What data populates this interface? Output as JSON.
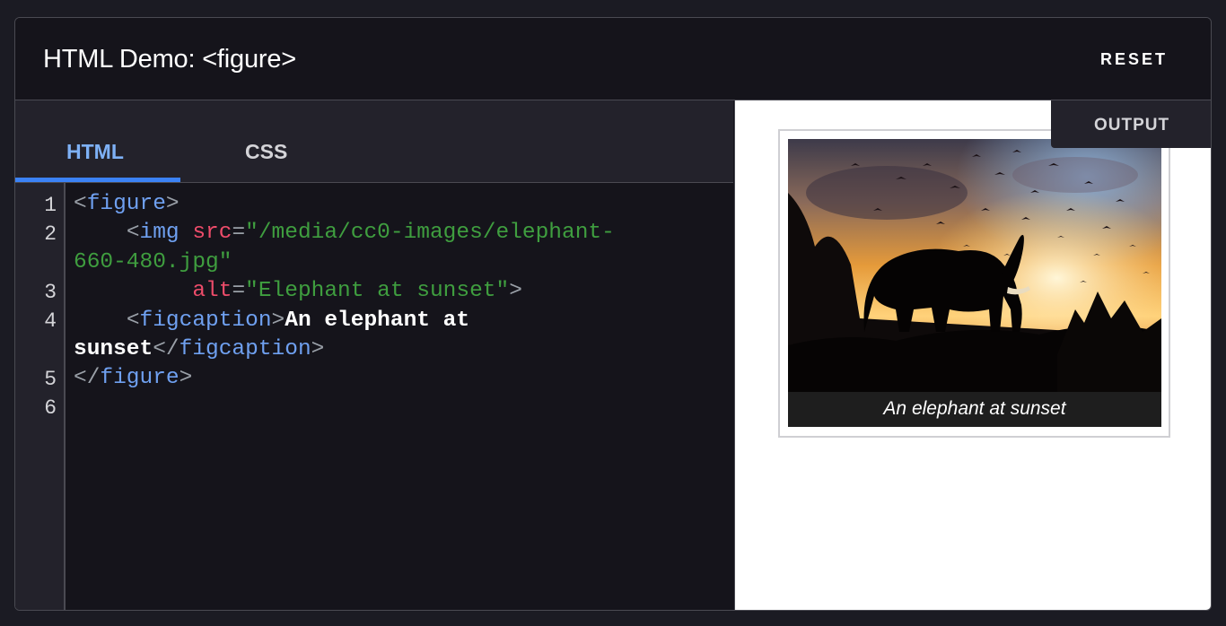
{
  "header": {
    "title": "HTML Demo: <figure>",
    "reset_label": "RESET"
  },
  "editor": {
    "tabs": [
      {
        "label": "HTML",
        "active": true
      },
      {
        "label": "CSS",
        "active": false
      }
    ],
    "line_numbers": [
      "1",
      "2",
      "3",
      "4",
      "5",
      "6"
    ],
    "code": {
      "l1_open": "<",
      "l1_tag": "figure",
      "l1_close": ">",
      "l2_indent": "    ",
      "l2_open": "<",
      "l2_tag": "img",
      "l2_attr": "src",
      "l2_eq": "=",
      "l2_val_a": "\"/media/cc0-images/elephant-",
      "l2_val_b": "660-480.jpg\"",
      "l3_indent": "         ",
      "l3_attr": "alt",
      "l3_eq": "=",
      "l3_val": "\"Elephant at sunset\"",
      "l3_close": ">",
      "l4_indent": "    ",
      "l4_open": "<",
      "l4_tag": "figcaption",
      "l4_close": ">",
      "l4_text_a": "An elephant at",
      "l4_text_b": "sunset",
      "l4_end_open": "</",
      "l4_end_tag": "figcaption",
      "l4_end_close": ">",
      "l5_open": "</",
      "l5_tag": "figure",
      "l5_close": ">"
    }
  },
  "output": {
    "tab_label": "OUTPUT",
    "figcaption": "An elephant at sunset"
  },
  "colors": {
    "accent": "#3b82f6",
    "tag": "#6fa0f0",
    "attribute": "#ed4c6a",
    "string": "#3f9e3f"
  }
}
